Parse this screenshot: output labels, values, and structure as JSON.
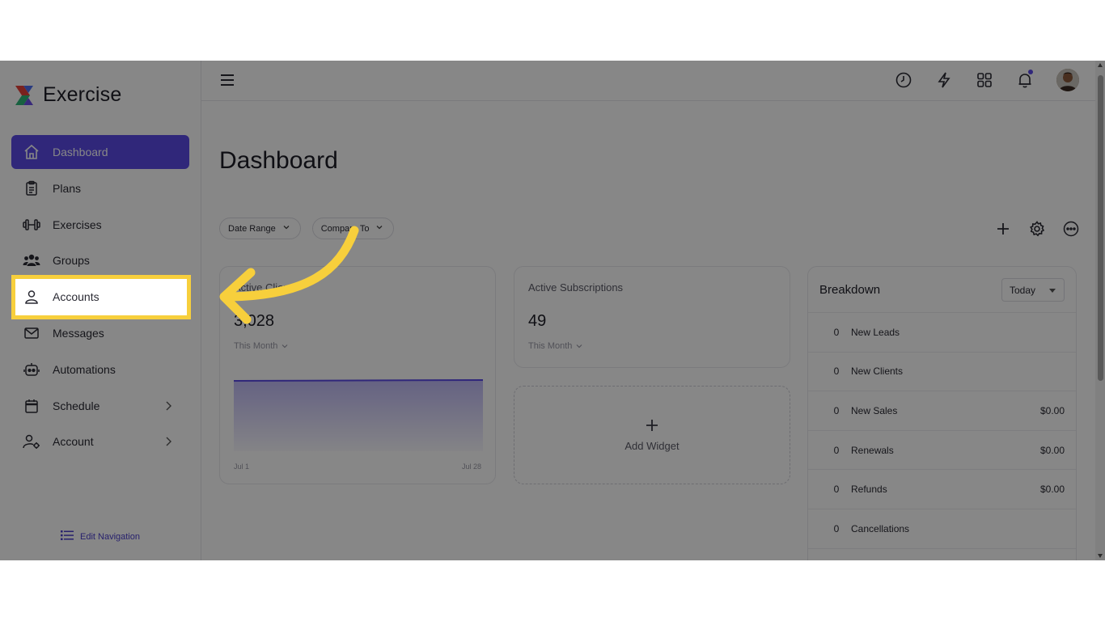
{
  "app": {
    "name": "Exercise"
  },
  "sidebar": {
    "items": [
      {
        "label": "Dashboard",
        "icon": "home-icon",
        "active": true
      },
      {
        "label": "Plans",
        "icon": "clipboard-icon"
      },
      {
        "label": "Exercises",
        "icon": "dumbbell-icon"
      },
      {
        "label": "Groups",
        "icon": "users-icon"
      },
      {
        "label": "Accounts",
        "icon": "user-icon",
        "highlighted": true
      },
      {
        "label": "Messages",
        "icon": "mail-icon"
      },
      {
        "label": "Automations",
        "icon": "robot-icon"
      },
      {
        "label": "Schedule",
        "icon": "calendar-icon",
        "chevron": true
      },
      {
        "label": "Account",
        "icon": "user-gear-icon",
        "chevron": true
      }
    ],
    "edit_navigation": "Edit Navigation"
  },
  "topbar": {
    "icons": [
      "clock-icon",
      "bolt-icon",
      "grid-icon",
      "bell-icon"
    ],
    "notification_dot": true
  },
  "page": {
    "title": "Dashboard",
    "filters": {
      "date_range": "Date Range",
      "compare_to": "Compare To"
    },
    "actions": [
      "plus-icon",
      "gear-icon",
      "more-icon"
    ]
  },
  "cards": {
    "active_clients": {
      "label": "Active Clients",
      "value": "3,028",
      "period": "This Month",
      "x_start": "Jul 1",
      "x_end": "Jul 28"
    },
    "active_subscriptions": {
      "label": "Active Subscriptions",
      "value": "49",
      "period": "This Month"
    },
    "add_widget": {
      "label": "Add Widget"
    }
  },
  "breakdown": {
    "title": "Breakdown",
    "select_value": "Today",
    "rows": [
      {
        "count": "0",
        "name": "New Leads",
        "amount": ""
      },
      {
        "count": "0",
        "name": "New Clients",
        "amount": ""
      },
      {
        "count": "0",
        "name": "New Sales",
        "amount": "$0.00"
      },
      {
        "count": "0",
        "name": "Renewals",
        "amount": "$0.00"
      },
      {
        "count": "0",
        "name": "Refunds",
        "amount": "$0.00"
      },
      {
        "count": "0",
        "name": "Cancellations",
        "amount": ""
      }
    ]
  },
  "colors": {
    "accent": "#5b4ae6",
    "highlight": "#f7cf3c"
  }
}
